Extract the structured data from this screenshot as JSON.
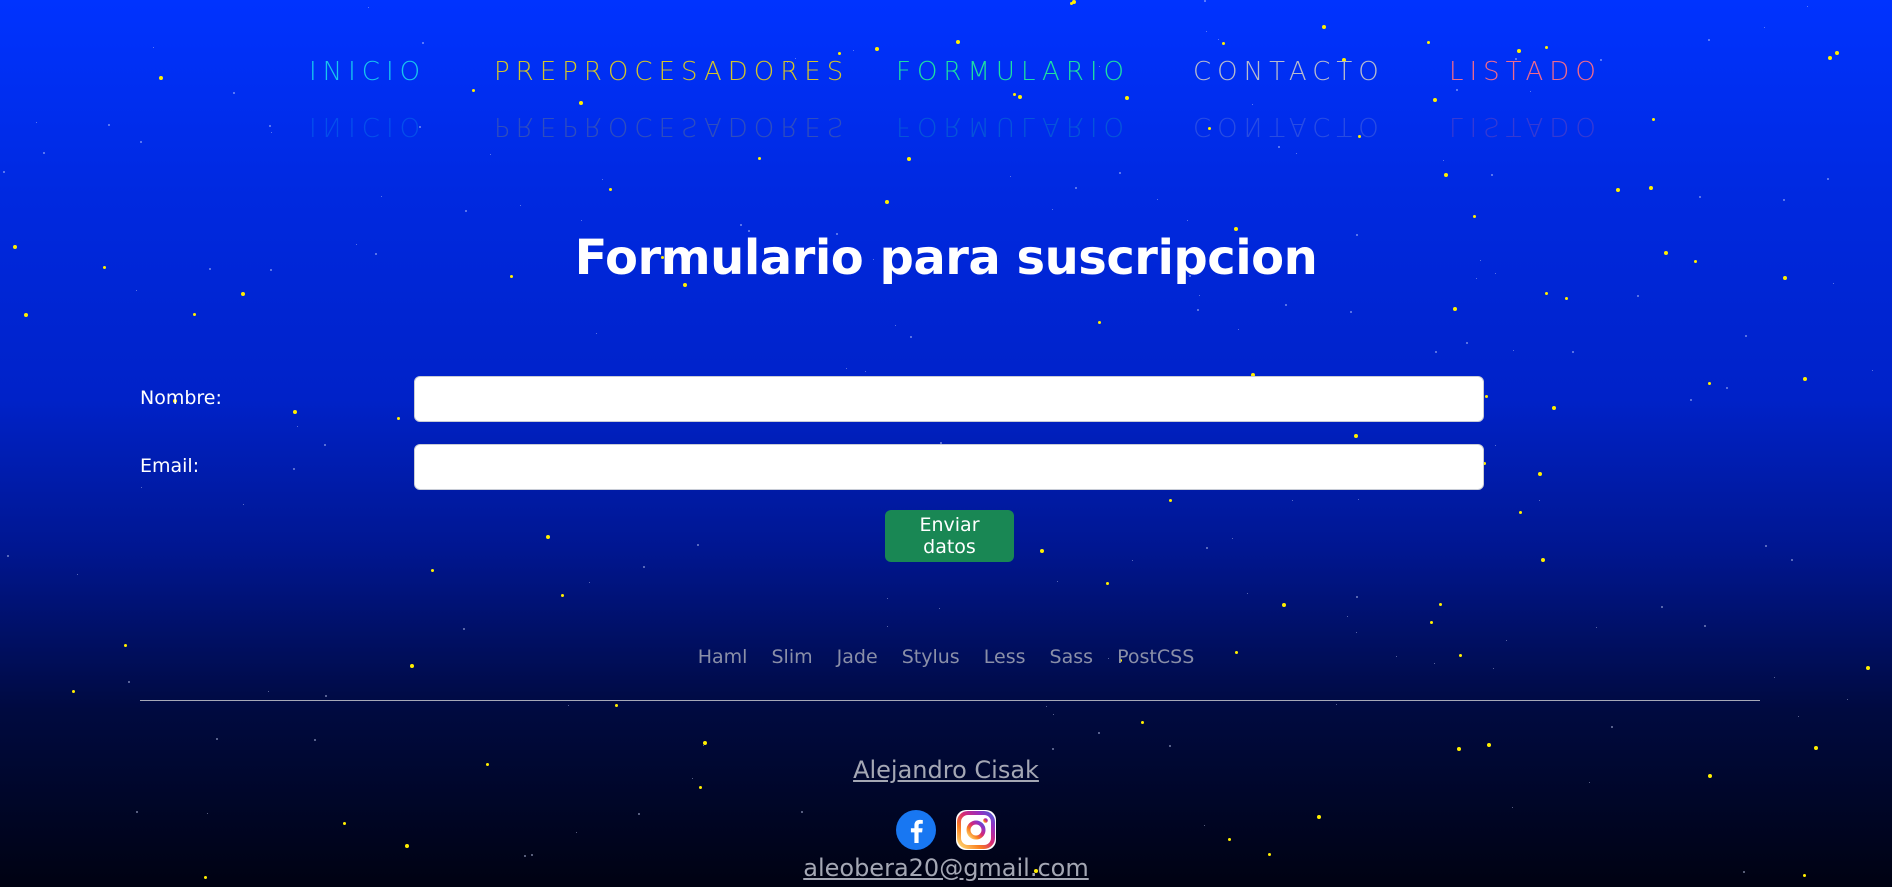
{
  "nav": {
    "items": [
      {
        "label": "INICIO",
        "color": "#18c6ee"
      },
      {
        "label": "PREPROCESADORES",
        "color": "#d4c428"
      },
      {
        "label": "FORMULARIO",
        "color": "#1ee0a0"
      },
      {
        "label": "CONTACTO",
        "color": "#b8bccc"
      },
      {
        "label": "LISTADO",
        "color": "#f06a8a"
      }
    ]
  },
  "form": {
    "title": "Formulario para suscripcion",
    "name_label": "Nombre:",
    "name_value": "",
    "email_label": "Email:",
    "email_value": "",
    "submit_label": "Enviar datos"
  },
  "footer": {
    "tech_links": [
      "Haml",
      "Slim",
      "Jade",
      "Stylus",
      "Less",
      "Sass",
      "PostCSS"
    ],
    "author": "Alejandro Cisak",
    "email": "aleobera20@gmail.com",
    "social_icons": [
      "facebook-icon",
      "instagram-icon"
    ]
  },
  "colors": {
    "background_top": "#0033ff",
    "background_bottom": "#000212",
    "star": "#ffee00",
    "submit_button": "#198754"
  }
}
